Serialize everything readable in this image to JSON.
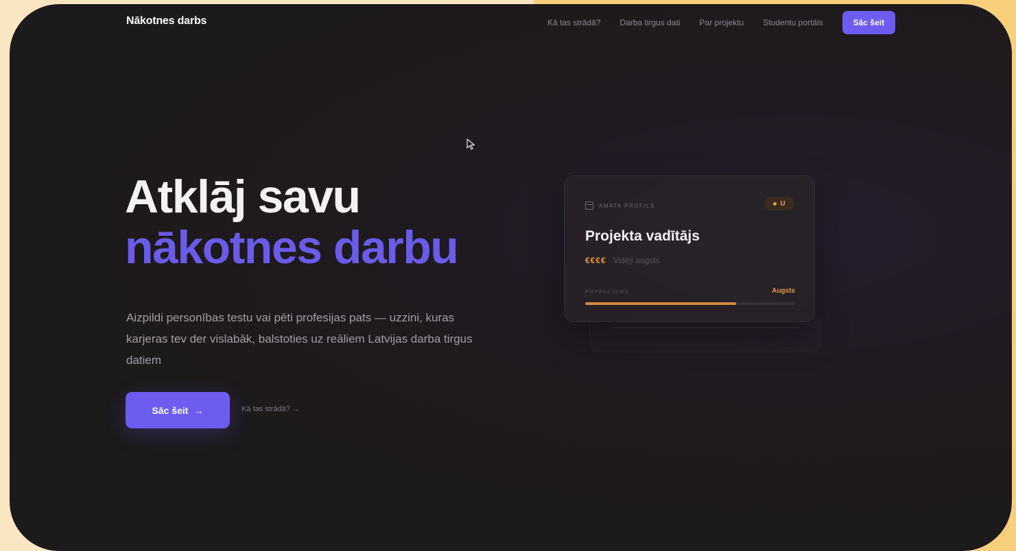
{
  "nav": {
    "brand": "Nākotnes darbs",
    "links": [
      "Kā tas strādā?",
      "Darba tirgus dati",
      "Par projektu",
      "Studentu portāls"
    ],
    "cta": "Sāc šeit"
  },
  "hero": {
    "headline_line1": "Atklāj savu",
    "headline_line2": "nākotnes darbu",
    "lead": "Aizpildi personības testu vai pēti profesijas pats — uzzini, kuras karjeras tev der vislabāk, balstoties uz reāliem Latvijas darba tirgus datiem",
    "primary_cta": "Sāc šeit",
    "primary_cta_arrow": "→",
    "secondary_link": "Kā tas strādā? →"
  },
  "card": {
    "eyebrow": "AMATA PROFILS",
    "badge": "U",
    "role": "Projekta vadītājs",
    "pay_symbol": "€€€€",
    "pay_note": "Vidēji augsts",
    "meter_label": "PIEPRASĪJUMS",
    "meter_value": "Augsts",
    "meter_fraction": 0.72
  },
  "colors": {
    "accent": "#6d5cf0",
    "headline_accent": "#6a5be8",
    "warm": "#e69a3d",
    "background": "#1c1a1b",
    "frame_backdrop": "#f7cf7d"
  }
}
